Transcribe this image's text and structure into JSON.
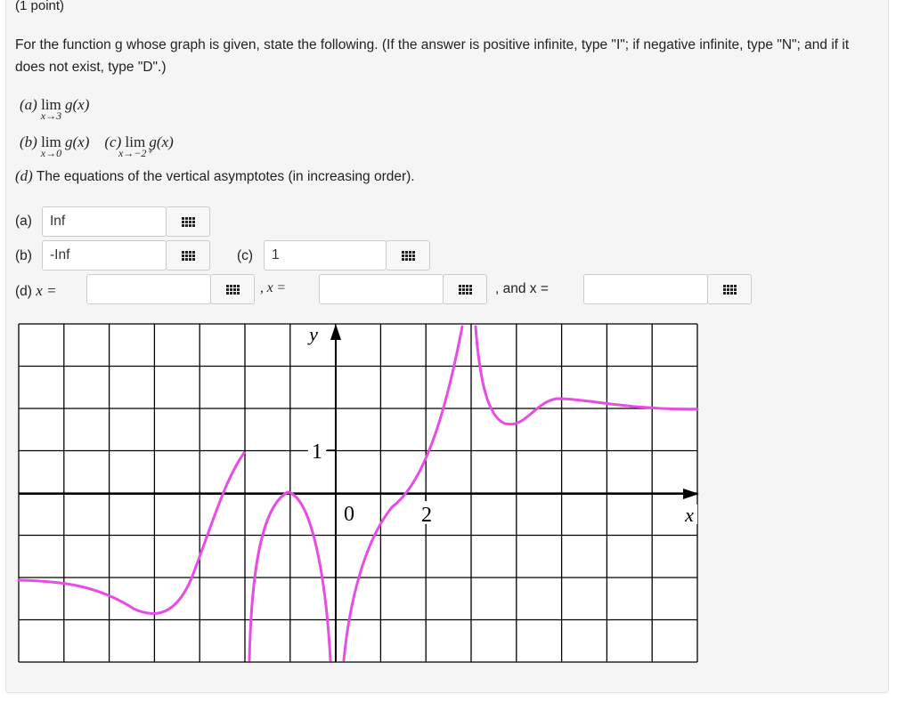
{
  "header": "(1 point)",
  "question": "For the function g whose graph is given, state the following. (If the answer is positive infinite, type \"I\"; if negative infinite, type \"N\"; and if it does not exist, type \"D\".)",
  "part_a": {
    "label": "(a)",
    "lim": "lim",
    "sub": "x→3",
    "func": "g(x)"
  },
  "part_b": {
    "label": "(b)",
    "lim": "lim",
    "sub": "x→0",
    "func": "g(x)"
  },
  "part_c": {
    "label": "(c)",
    "lim": "lim",
    "sub": "x→−2⁺",
    "func": "g(x)"
  },
  "part_d": {
    "label": "(d)",
    "text": "The equations of the vertical asymptotes (in increasing order)."
  },
  "answers": {
    "a_label": "(a)",
    "a_value": "Inf",
    "b_label": "(b)",
    "b_value": "-Inf",
    "c_label": "(c)",
    "c_value": "1",
    "d_label": "(d)",
    "d_x": "x =",
    "sep2": ", x =",
    "sep3": ", and x =",
    "d1_value": "",
    "d2_value": "",
    "d3_value": ""
  },
  "graph": {
    "y_axis_label": "y",
    "x_axis_label": "x",
    "origin_label": "0",
    "x_tick_label": "2",
    "y_tick_label": "1",
    "curve_color": "#e94be6"
  }
}
